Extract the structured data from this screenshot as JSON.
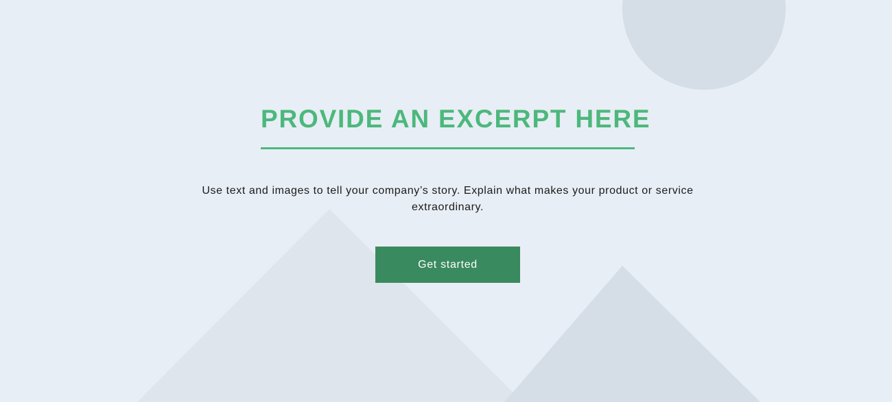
{
  "hero": {
    "headline": "PROVIDE AN EXCERPT HERE",
    "body": "Use text and images to tell your company’s story. Explain what makes your product or service extraordinary.",
    "cta_label": "Get started"
  },
  "colors": {
    "background": "#e8eef5",
    "accent": "#4cb87c",
    "button": "#3a8a5f",
    "shape_light": "#dfe5ed",
    "shape_dark": "#d5dde6"
  },
  "icons": {
    "background": "image-placeholder-icon"
  }
}
